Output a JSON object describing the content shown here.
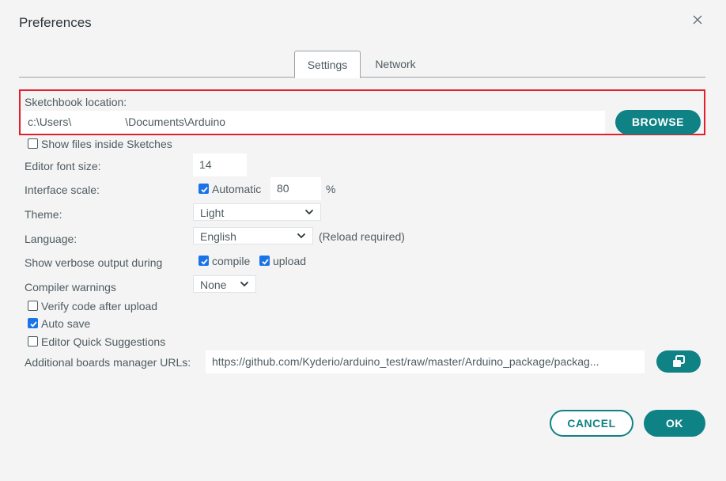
{
  "dialog": {
    "title": "Preferences"
  },
  "tabs": [
    {
      "label": "Settings",
      "active": true
    },
    {
      "label": "Network",
      "active": false
    }
  ],
  "sketchbook": {
    "label": "Sketchbook location:",
    "path_prefix": "c:\\Users\\",
    "path_suffix": "\\Documents\\Arduino",
    "browse_label": "BROWSE"
  },
  "show_files": {
    "label": "Show files inside Sketches",
    "checked": false
  },
  "font_size": {
    "label": "Editor font size:",
    "value": "14"
  },
  "interface_scale": {
    "label": "Interface scale:",
    "automatic_label": "Automatic",
    "automatic_checked": true,
    "value": "80",
    "unit": "%"
  },
  "theme": {
    "label": "Theme:",
    "value": "Light"
  },
  "language": {
    "label": "Language:",
    "value": "English",
    "note": "(Reload required)"
  },
  "verbose": {
    "label": "Show verbose output during",
    "compile_label": "compile",
    "compile_checked": true,
    "upload_label": "upload",
    "upload_checked": true
  },
  "compiler_warnings": {
    "label": "Compiler warnings",
    "value": "None"
  },
  "verify_upload": {
    "label": "Verify code after upload",
    "checked": false
  },
  "auto_save": {
    "label": "Auto save",
    "checked": true
  },
  "quick_suggestions": {
    "label": "Editor Quick Suggestions",
    "checked": false
  },
  "boards_urls": {
    "label": "Additional boards manager URLs:",
    "value": "https://github.com/Kyderio/arduino_test/raw/master/Arduino_package/packag..."
  },
  "footer": {
    "cancel_label": "CANCEL",
    "ok_label": "OK"
  },
  "colors": {
    "accent": "#0f8285",
    "highlight_border": "#e3202a",
    "checkbox": "#1a73e8"
  }
}
